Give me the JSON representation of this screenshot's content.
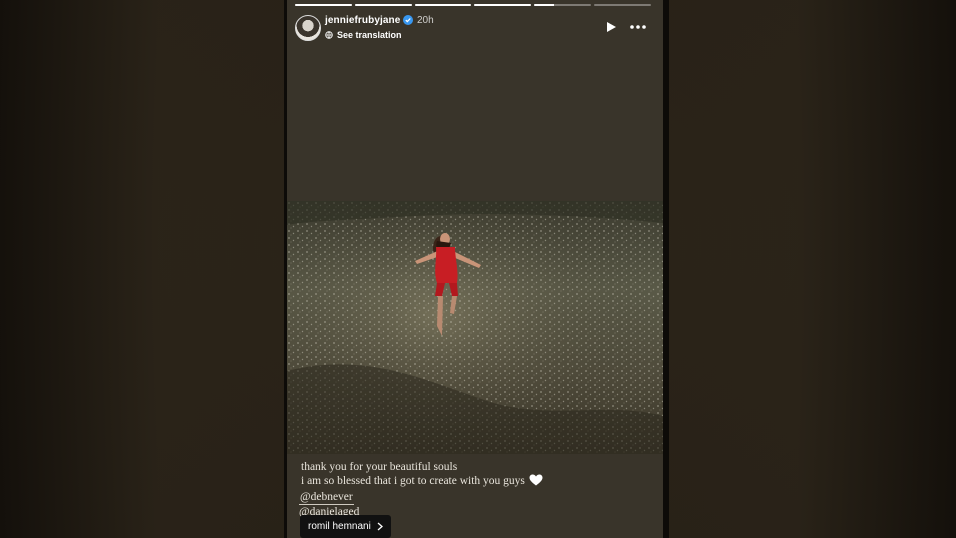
{
  "story": {
    "username": "jenniefrubyjane",
    "time_ago": "20h",
    "translate_label": "See translation",
    "progress": [
      1,
      1,
      1,
      1,
      0.35,
      0
    ],
    "caption_lines": [
      "thank you for your beautiful souls",
      "i am so blessed that i got to create with you guys"
    ],
    "mentions": [
      "@debnever",
      "@danielaged"
    ],
    "tag_label": "romil hemnani"
  },
  "icons": {
    "verified": "verified-badge-icon",
    "globe": "globe-icon",
    "play": "play-icon",
    "more": "more-options-icon",
    "heart": "white-heart-icon",
    "chevron": "chevron-right-icon"
  },
  "colors": {
    "story_bg": "#39342a",
    "dress": "#c81e24",
    "verified": "#3897f0"
  }
}
